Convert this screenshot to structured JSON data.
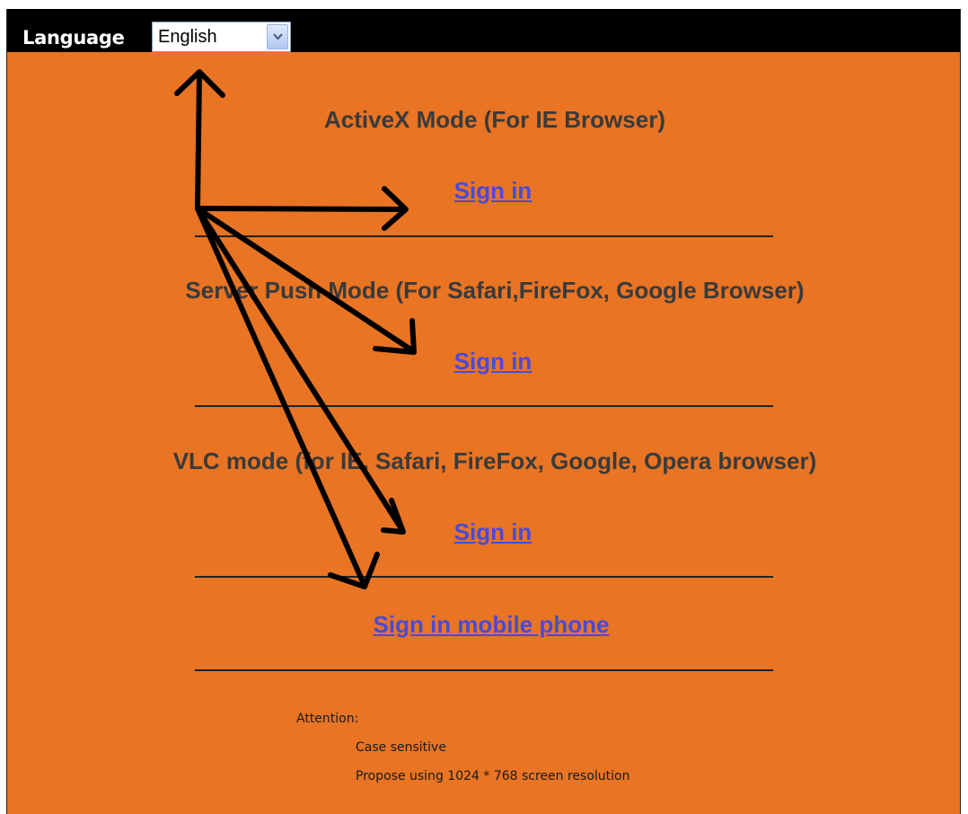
{
  "language": {
    "label": "Language",
    "selected": "English"
  },
  "modes": [
    {
      "title": "ActiveX Mode (For IE Browser)",
      "signin": "Sign in"
    },
    {
      "title": "Server Push Mode (For Safari,FireFox, Google Browser)",
      "signin": "Sign in"
    },
    {
      "title": "VLC mode (for IE, Safari, FireFox, Google, Opera browser)",
      "signin": "Sign in"
    }
  ],
  "mobile": {
    "signin": "Sign in mobile phone"
  },
  "attention": {
    "label": "Attention:",
    "items": [
      "Case sensitive",
      "Propose using 1024 * 768 screen resolution"
    ]
  },
  "colors": {
    "background": "#e87424",
    "topbar": "#000000",
    "link": "#4a4ad8",
    "heading": "#3a3a3a"
  },
  "icons": {
    "dropdown": "chevron-down-icon",
    "annotation": "arrow-icon"
  }
}
